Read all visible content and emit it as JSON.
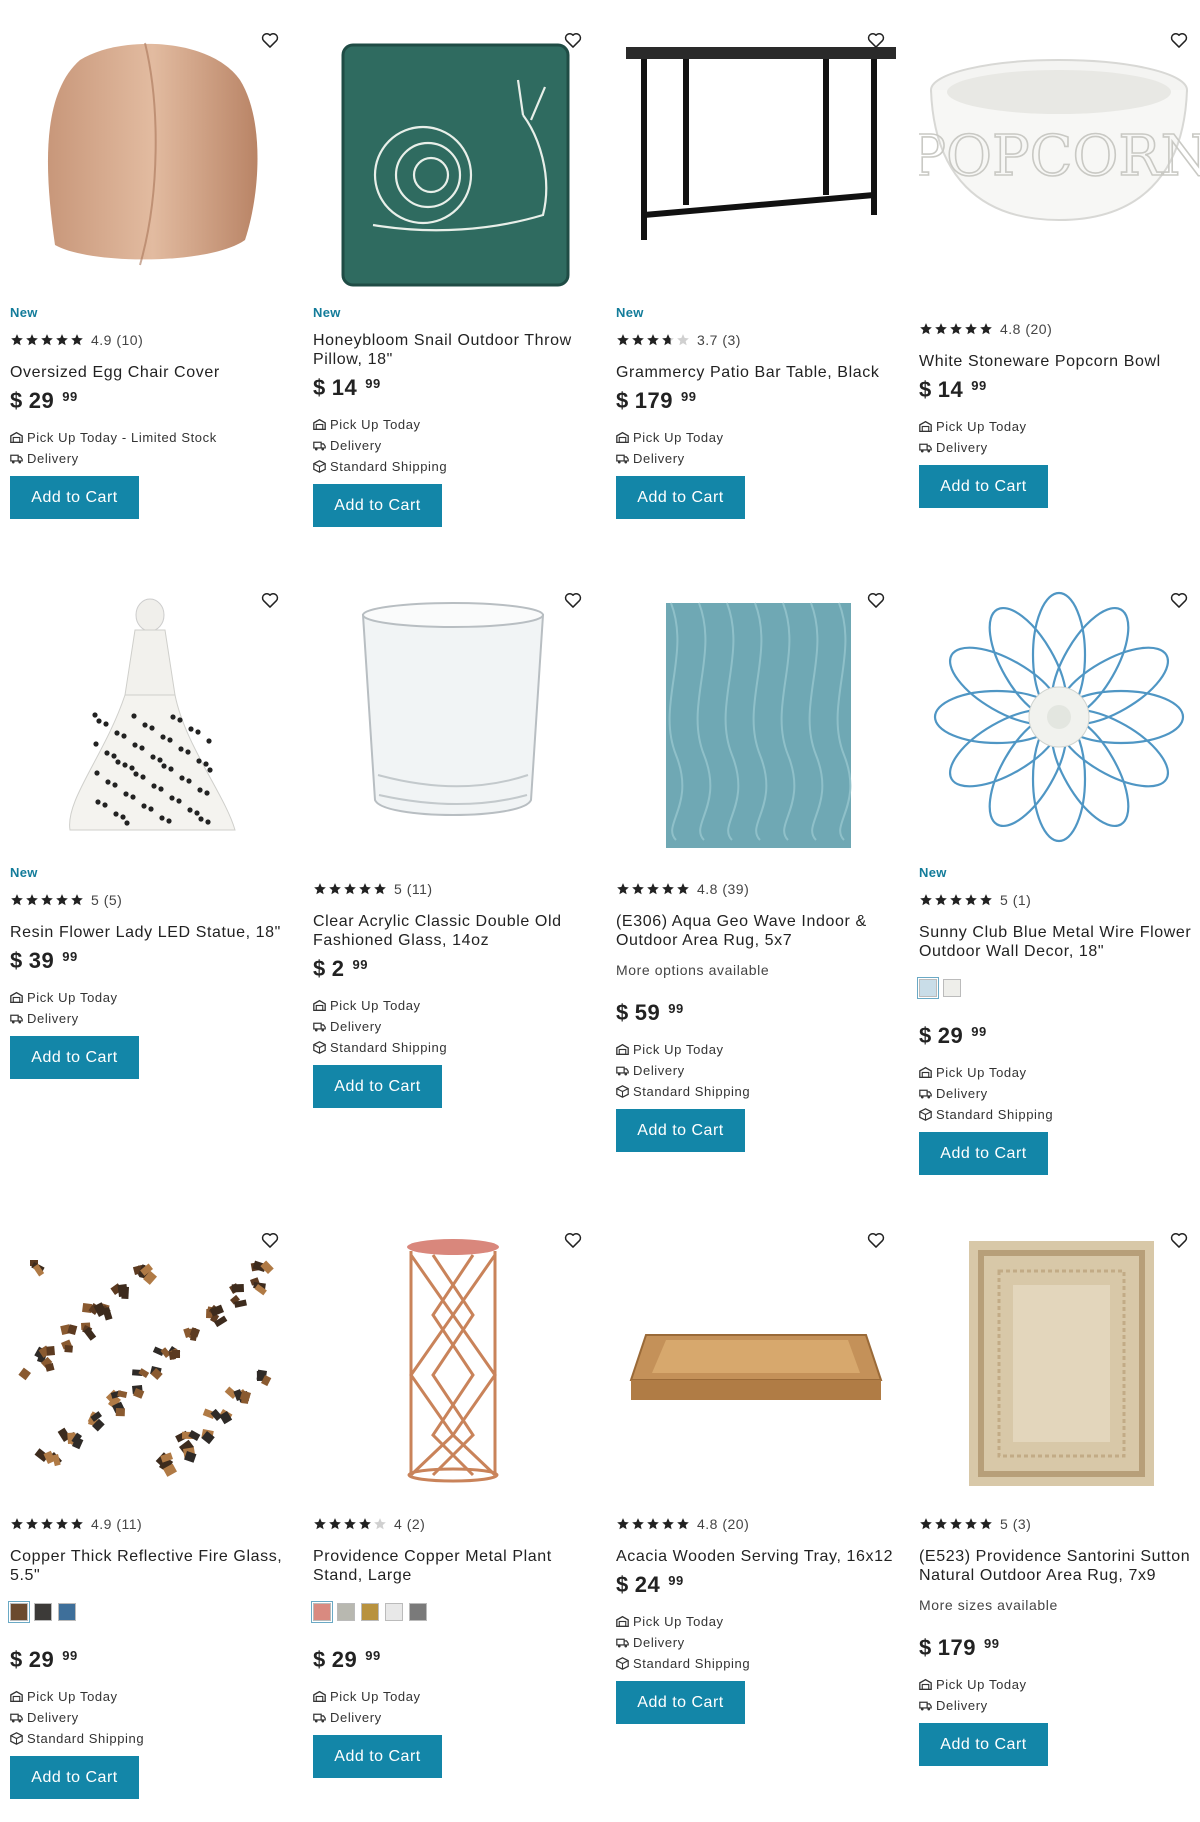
{
  "colors": {
    "accent": "#1386a8",
    "badge": "#137c9a",
    "star": "#222222"
  },
  "products": [
    {
      "badge": "New",
      "rating": "4.9",
      "count": "(10)",
      "stars": 5,
      "title1": "Oversized Egg Chair Cover",
      "title2": "",
      "options": "",
      "price_dollars": "29",
      "price_cents": "99",
      "currency": "$",
      "fulfillment": [
        "Pick Up Today - Limited Stock",
        "Delivery"
      ],
      "button": "Add to Cart",
      "image_icon": "egg-chair-cover-image"
    },
    {
      "badge": "New",
      "rating": "",
      "count": "",
      "stars": 0,
      "title1": "Honeybloom Snail Outdoor Throw",
      "title2": "Pillow, 18\"",
      "options": "",
      "price_dollars": "14",
      "price_cents": "99",
      "currency": "$",
      "fulfillment": [
        "Pick Up Today",
        "Delivery",
        "Standard Shipping"
      ],
      "button": "Add to Cart",
      "image_icon": "snail-pillow-image"
    },
    {
      "badge": "New",
      "rating": "3.7",
      "count": "(3)",
      "stars": 3.7,
      "title1": "Grammercy Patio Bar Table, Black",
      "title2": "",
      "options": "",
      "price_dollars": "179",
      "price_cents": "99",
      "currency": "$",
      "fulfillment": [
        "Pick Up Today",
        "Delivery"
      ],
      "button": "Add to Cart",
      "image_icon": "bar-table-image"
    },
    {
      "badge": "",
      "rating": "4.8",
      "count": "(20)",
      "stars": 5,
      "title1": "White Stoneware Popcorn Bowl",
      "title2": "",
      "options": "",
      "price_dollars": "14",
      "price_cents": "99",
      "currency": "$",
      "fulfillment": [
        "Pick Up Today",
        "Delivery"
      ],
      "button": "Add to Cart",
      "image_icon": "popcorn-bowl-image",
      "image_text": "POPCORN"
    },
    {
      "badge": "New",
      "rating": "5",
      "count": "(5)",
      "stars": 5,
      "title1": "Resin Flower Lady LED Statue, 18\"",
      "title2": "",
      "options": "",
      "price_dollars": "39",
      "price_cents": "99",
      "currency": "$",
      "fulfillment": [
        "Pick Up Today",
        "Delivery"
      ],
      "button": "Add to Cart",
      "image_icon": "flower-lady-statue-image"
    },
    {
      "badge": "",
      "rating": "5",
      "count": "(11)",
      "stars": 5,
      "title1": "Clear Acrylic Classic Double Old",
      "title2": "Fashioned Glass, 14oz",
      "options": "",
      "price_dollars": "2",
      "price_cents": "99",
      "currency": "$",
      "fulfillment": [
        "Pick Up Today",
        "Delivery",
        "Standard Shipping"
      ],
      "button": "Add to Cart",
      "image_icon": "acrylic-glass-image"
    },
    {
      "badge": "",
      "rating": "4.8",
      "count": "(39)",
      "stars": 5,
      "title1": "(E306) Aqua Geo Wave Indoor &",
      "title2": "Outdoor Area Rug, 5x7",
      "options": "More options available",
      "price_dollars": "59",
      "price_cents": "99",
      "currency": "$",
      "fulfillment": [
        "Pick Up Today",
        "Delivery",
        "Standard Shipping"
      ],
      "button": "Add to Cart",
      "image_icon": "aqua-rug-image"
    },
    {
      "badge": "New",
      "rating": "5",
      "count": "(1)",
      "stars": 5,
      "title1": "Sunny Club Blue Metal Wire Flower",
      "title2": "Outdoor Wall Decor, 18\"",
      "options": "",
      "swatches": [
        "#c9dde8",
        "#eeeeea"
      ],
      "price_dollars": "29",
      "price_cents": "99",
      "currency": "$",
      "fulfillment": [
        "Pick Up Today",
        "Delivery",
        "Standard Shipping"
      ],
      "button": "Add to Cart",
      "image_icon": "wire-flower-image"
    },
    {
      "badge": "",
      "rating": "4.9",
      "count": "(11)",
      "stars": 5,
      "title1": "Copper Thick Reflective Fire Glass,",
      "title2": "5.5\"",
      "options": "",
      "swatches": [
        "#6b4a2e",
        "#3c3a38",
        "#3e6f9a"
      ],
      "price_dollars": "29",
      "price_cents": "99",
      "currency": "$",
      "fulfillment": [
        "Pick Up Today",
        "Delivery",
        "Standard Shipping"
      ],
      "button": "Add to Cart",
      "image_icon": "fire-glass-image"
    },
    {
      "badge": "",
      "rating": "4",
      "count": "(2)",
      "stars": 4,
      "title1": "Providence Copper Metal Plant",
      "title2": "Stand, Large",
      "options": "",
      "swatches": [
        "#d98a80",
        "#b8b8b0",
        "#b8923e",
        "#e8e8e8",
        "#7a7a7a"
      ],
      "price_dollars": "29",
      "price_cents": "99",
      "currency": "$",
      "fulfillment": [
        "Pick Up Today",
        "Delivery"
      ],
      "button": "Add to Cart",
      "image_icon": "plant-stand-image"
    },
    {
      "badge": "",
      "rating": "4.8",
      "count": "(20)",
      "stars": 5,
      "title1": "Acacia Wooden Serving Tray, 16x12",
      "title2": "",
      "options": "",
      "price_dollars": "24",
      "price_cents": "99",
      "currency": "$",
      "fulfillment": [
        "Pick Up Today",
        "Delivery",
        "Standard Shipping"
      ],
      "button": "Add to Cart",
      "image_icon": "serving-tray-image"
    },
    {
      "badge": "",
      "rating": "5",
      "count": "(3)",
      "stars": 5,
      "title1": "(E523) Providence Santorini Sutton",
      "title2": "Natural Outdoor Area Rug, 7x9",
      "options": "More sizes available",
      "price_dollars": "179",
      "price_cents": "99",
      "currency": "$",
      "fulfillment": [
        "Pick Up Today",
        "Delivery"
      ],
      "button": "Add to Cart",
      "image_icon": "natural-rug-image"
    }
  ]
}
